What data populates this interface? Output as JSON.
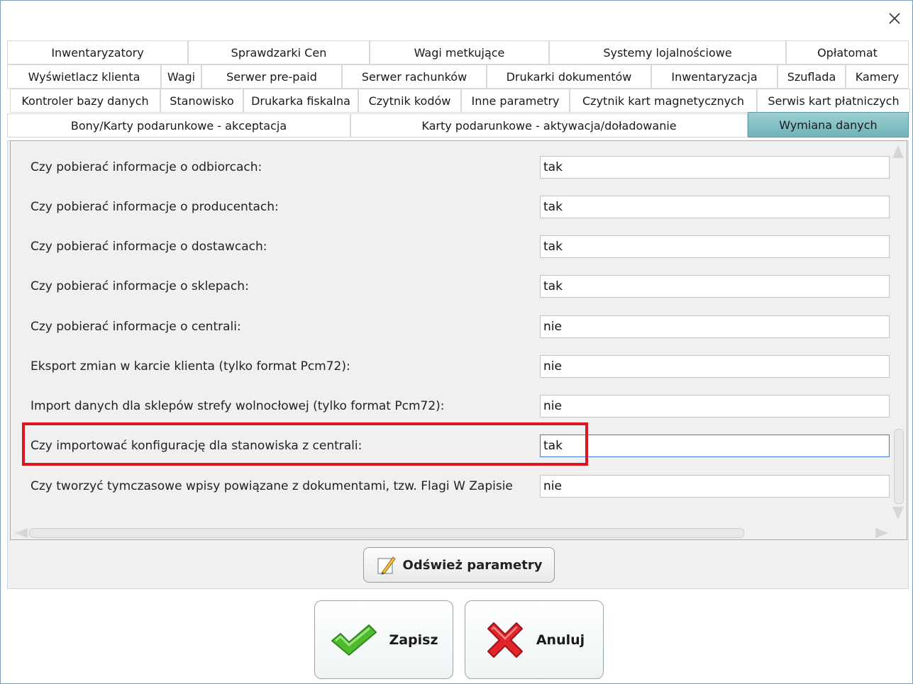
{
  "window": {
    "close_icon": "close-icon"
  },
  "tabs": {
    "row1": [
      "Inwentaryzatory",
      "Sprawdzarki Cen",
      "Wagi metkujące",
      "Systemy lojalnościowe",
      "Opłatomat"
    ],
    "row2": [
      "Wyświetlacz klienta",
      "Wagi",
      "Serwer pre-paid",
      "Serwer rachunków",
      "Drukarki dokumentów",
      "Inwentaryzacja",
      "Szuflada",
      "Kamery"
    ],
    "row3": [
      "Kontroler bazy danych",
      "Stanowisko",
      "Drukarka fiskalna",
      "Czytnik kodów",
      "Inne parametry",
      "Czytnik kart magnetycznych",
      "Serwis kart płatniczych"
    ],
    "row4": [
      "Bony/Karty podarunkowe - akceptacja",
      "Karty podarunkowe - aktywacja/doładowanie",
      "Wymiana danych"
    ],
    "active": "Wymiana danych",
    "active_color": "#7fbfc3"
  },
  "params": [
    {
      "label": "Czy pobierać informacje o odbiorcach:",
      "value": "tak"
    },
    {
      "label": "Czy pobierać informacje o producentach:",
      "value": "tak"
    },
    {
      "label": "Czy pobierać informacje o dostawcach:",
      "value": "tak"
    },
    {
      "label": "Czy pobierać informacje o sklepach:",
      "value": "tak"
    },
    {
      "label": "Czy pobierać informacje o centrali:",
      "value": "nie"
    },
    {
      "label": "Eksport zmian w karcie klienta (tylko format Pcm72):",
      "value": "nie"
    },
    {
      "label": "Import danych dla sklepów strefy wolnocłowej (tylko format Pcm72):",
      "value": "nie"
    },
    {
      "label": "Czy importować konfigurację dla stanowiska z centrali:",
      "value": "tak",
      "highlighted": true
    },
    {
      "label": "Czy tworzyć tymczasowe wpisy powiązane z dokumentami, tzw. Flagi W Zapisie",
      "value": "nie"
    }
  ],
  "highlight_color": "#e0141e",
  "buttons": {
    "refresh": {
      "label": "Odśwież parametry",
      "icon": "pencil-icon"
    },
    "save": {
      "label": "Zapisz",
      "icon": "checkmark-icon",
      "color": "#3fae2a"
    },
    "cancel": {
      "label": "Anuluj",
      "icon": "x-cross-icon",
      "color": "#e0141e"
    }
  }
}
